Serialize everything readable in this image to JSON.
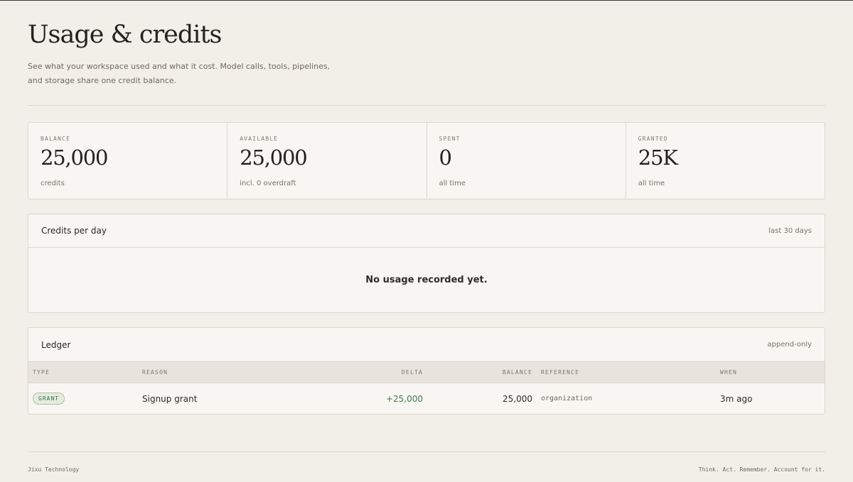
{
  "header": {
    "title": "Usage & credits",
    "subtitle": "See what your workspace used and what it cost. Model calls, tools, pipelines, and storage share one credit balance."
  },
  "stats": [
    {
      "label": "BALANCE",
      "value": "25,000",
      "sub": "credits"
    },
    {
      "label": "AVAILABLE",
      "value": "25,000",
      "sub": "incl. 0 overdraft"
    },
    {
      "label": "SPENT",
      "value": "0",
      "sub": "all time"
    },
    {
      "label": "GRANTED",
      "value": "25K",
      "sub": "all time"
    }
  ],
  "chart_panel": {
    "title": "Credits per day",
    "meta": "last 30 days",
    "empty_text": "No usage recorded yet."
  },
  "ledger": {
    "title": "Ledger",
    "meta": "append-only",
    "columns": {
      "type": "TYPE",
      "reason": "REASON",
      "delta": "DELTA",
      "balance": "BALANCE",
      "reference": "REFERENCE",
      "when": "WHEN"
    },
    "rows": [
      {
        "type": "GRANT",
        "reason": "Signup grant",
        "delta": "+25,000",
        "balance": "25,000",
        "reference": "organization",
        "when": "3m ago"
      }
    ]
  },
  "footer": {
    "left": "Jixu Technology",
    "right": "Think. Act. Remember. Account for it."
  },
  "colors": {
    "background": "#f2eee8",
    "card": "#f8f6f2",
    "positive": "#3f7a4f"
  }
}
